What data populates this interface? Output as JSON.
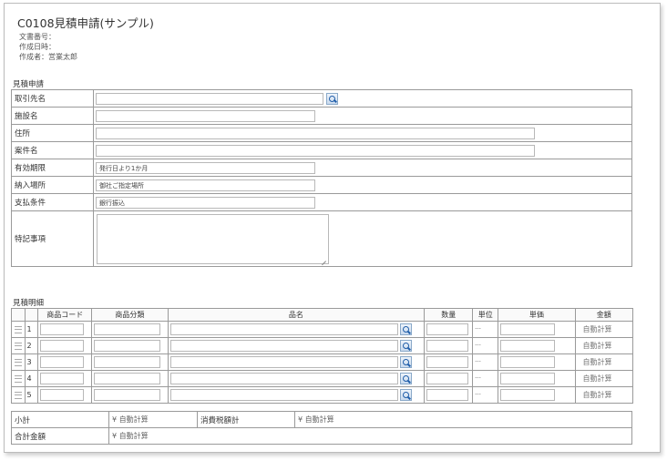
{
  "document": {
    "title": "C0108見積申請(サンプル)",
    "doc_number_label": "文書番号：",
    "created_date_label": "作成日時：",
    "author_label": "作成者：",
    "author_value": "営業太郎"
  },
  "estimate_section": {
    "label": "見積申請",
    "fields": [
      {
        "label": "取引先名",
        "value": "",
        "has_search": true
      },
      {
        "label": "施設名",
        "value": ""
      },
      {
        "label": "住所",
        "value": ""
      },
      {
        "label": "案件名",
        "value": ""
      },
      {
        "label": "有効期限",
        "value": "発行日より1か月"
      },
      {
        "label": "納入場所",
        "value": "御社ご指定場所"
      },
      {
        "label": "支払条件",
        "value": "銀行振込"
      },
      {
        "label": "特記事項",
        "value": ""
      }
    ]
  },
  "detail_section": {
    "label": "見積明細",
    "columns": [
      "商品コード",
      "商品分類",
      "品名",
      "数量",
      "単位",
      "単価",
      "金額"
    ],
    "rows": [
      {
        "num": "1",
        "unit": "---",
        "amount": "自動計算"
      },
      {
        "num": "2",
        "unit": "---",
        "amount": "自動計算"
      },
      {
        "num": "3",
        "unit": "---",
        "amount": "自動計算"
      },
      {
        "num": "4",
        "unit": "---",
        "amount": "自動計算"
      },
      {
        "num": "5",
        "unit": "---",
        "amount": "自動計算"
      }
    ]
  },
  "summary": {
    "subtotal_label": "小計",
    "subtotal_value": "¥ 自動計算",
    "tax_label": "消費税額計",
    "tax_value": "¥ 自動計算",
    "total_label": "合計金額",
    "total_value": "¥ 自動計算"
  },
  "icons": {
    "search": "search-icon",
    "drag": "drag-handle-icon",
    "resize": "resize-grip-icon"
  }
}
